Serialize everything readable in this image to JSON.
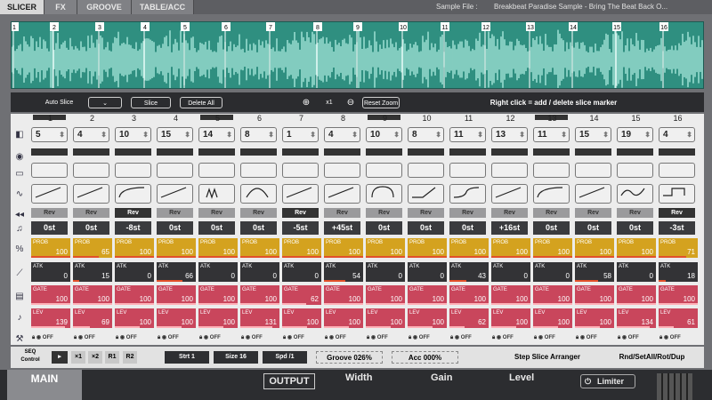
{
  "tabs": [
    "SLICER",
    "FX",
    "GROOVE",
    "TABLE/ACC"
  ],
  "sample_file_label": "Sample File :",
  "sample_file_name": "Breakbeat Paradise Sample - Bring The Beat Back O...",
  "toolbar": {
    "auto_slice": "Auto Slice",
    "slice": "Slice",
    "delete_all": "Delete All",
    "zoom": "x1",
    "reset_zoom": "Reset Zoom",
    "hint": "Right click = add / delete slice marker"
  },
  "columns": [
    "1",
    "2",
    "3",
    "4",
    "5",
    "6",
    "7",
    "8",
    "9",
    "10",
    "11",
    "12",
    "13",
    "14",
    "15",
    "16"
  ],
  "selected_columns": [
    0,
    4,
    8,
    12
  ],
  "slice_values": [
    "5",
    "4",
    "10",
    "15",
    "14",
    "8",
    "1",
    "4",
    "10",
    "8",
    "11",
    "13",
    "11",
    "15",
    "19",
    "4"
  ],
  "env_shapes": [
    "line",
    "line",
    "curve",
    "line",
    "mm",
    "hill",
    "line",
    "line",
    "arch",
    "ramp",
    "scurve",
    "line",
    "curve",
    "line",
    "wave",
    "step"
  ],
  "rev_label": "Rev",
  "rev_on": [
    2,
    6,
    15
  ],
  "semitones": [
    "0st",
    "0st",
    "-8st",
    "0st",
    "0st",
    "0st",
    "-5st",
    "+45st",
    "0st",
    "0st",
    "0st",
    "+16st",
    "0st",
    "0st",
    "0st",
    "-3st"
  ],
  "prob": {
    "label": "PROB",
    "values": [
      "100",
      "65",
      "100",
      "100",
      "100",
      "100",
      "100",
      "100",
      "100",
      "100",
      "100",
      "100",
      "100",
      "100",
      "100",
      "71"
    ]
  },
  "atk": {
    "label": "ATK",
    "values": [
      "0",
      "15",
      "0",
      "66",
      "0",
      "0",
      "0",
      "54",
      "0",
      "0",
      "43",
      "0",
      "0",
      "58",
      "0",
      "18"
    ]
  },
  "gate": {
    "label": "GATE",
    "values": [
      "100",
      "100",
      "100",
      "100",
      "100",
      "100",
      "62",
      "100",
      "100",
      "100",
      "100",
      "100",
      "100",
      "100",
      "100",
      "100"
    ]
  },
  "lev": {
    "label": "LEV",
    "values": [
      "139",
      "69",
      "100",
      "100",
      "100",
      "131",
      "100",
      "100",
      "100",
      "100",
      "62",
      "100",
      "100",
      "100",
      "134",
      "61"
    ]
  },
  "off_label": "OFF",
  "seq": {
    "control": "SEQ\nControl",
    "buttons": [
      "×1",
      "×2",
      "R1",
      "R2"
    ],
    "strt": "Strt 1",
    "size": "Size 16",
    "spd": "Spd /1",
    "groove": "Groove 026%",
    "acc": "Acc 000%",
    "arranger": "Step Slice Arranger",
    "rnd": "Rnd/SetAll/Rot/Dup"
  },
  "bottom": {
    "main": "MAIN",
    "output": "OUTPUT",
    "width": "Width",
    "gain": "Gain",
    "level": "Level",
    "limiter": "Limiter"
  },
  "colors": {
    "prob": "#d4a21f",
    "atk": "#333336",
    "gate": "#c9465c",
    "lev": "#c9465c",
    "accent": "#e2502a",
    "wave": "#2f8f80"
  }
}
